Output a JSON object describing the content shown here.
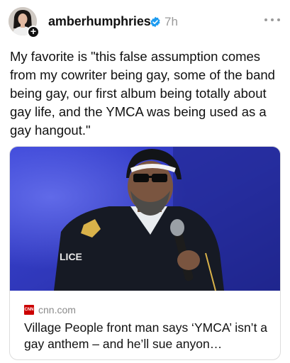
{
  "post": {
    "username": "amberhumphries",
    "time": "7h",
    "text": "My favorite is \"this false assumption comes from my cowriter being gay, some of the band being gay, our first album being totally about gay life, and the YMCA was being used as a gay hangout.\""
  },
  "link_card": {
    "source_logo": "CNN",
    "domain": "cnn.com",
    "title": "Village People front man says ‘YMCA’ isn’t a gay anthem – and he’ll sue anyon…",
    "image_badge_text": "LICE"
  },
  "icons": {
    "avatar": "profile-avatar",
    "follow": "plus-icon",
    "verified": "verified-badge-icon",
    "more": "more-options-icon"
  },
  "colors": {
    "verified_blue": "#1d9bf0",
    "cnn_red": "#cc0000",
    "muted_text": "#9a9a9a"
  }
}
